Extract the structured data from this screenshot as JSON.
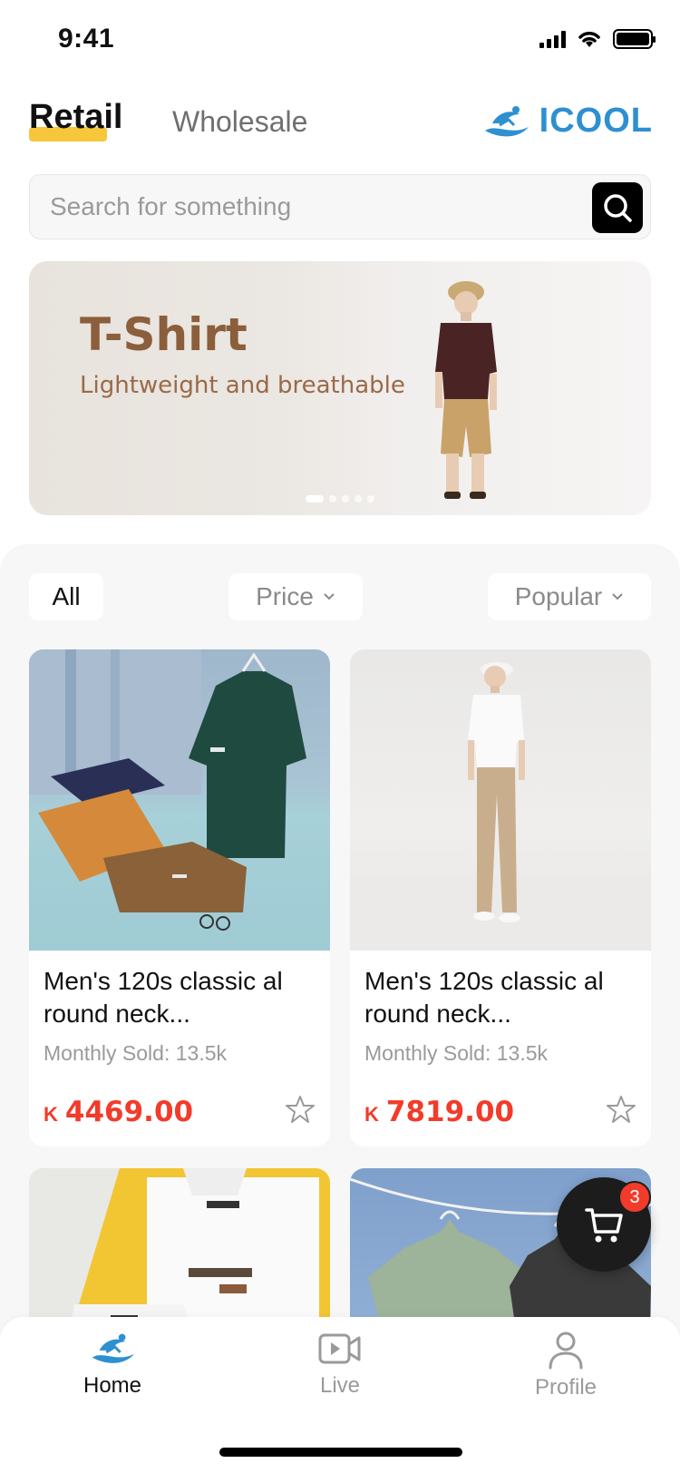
{
  "status_bar": {
    "time": "9:41"
  },
  "header": {
    "tabs": [
      {
        "label": "Retail",
        "active": true
      },
      {
        "label": "Wholesale",
        "active": false
      }
    ],
    "brand": {
      "name": "ICOOL",
      "color": "#2E8FD1"
    }
  },
  "search": {
    "placeholder": "Search for something",
    "icon": "search-icon"
  },
  "banner": {
    "title": "T-Shirt",
    "subtitle": "Lightweight and breathable",
    "slide_count": 5,
    "active_slide": 1
  },
  "filters": {
    "all_label": "All",
    "price_label": "Price",
    "popular_label": "Popular"
  },
  "products": [
    {
      "title": "Men's 120s classic al round neck...",
      "sold": "Monthly Sold: 13.5k",
      "currency": "K",
      "price": "4469.00"
    },
    {
      "title": "Men's 120s classic al round neck...",
      "sold": "Monthly Sold: 13.5k",
      "currency": "K",
      "price": "7819.00"
    }
  ],
  "cart": {
    "count": "3"
  },
  "bottom_nav": [
    {
      "label": "Home",
      "icon": "home-logo-icon",
      "active": true
    },
    {
      "label": "Live",
      "icon": "video-icon",
      "active": false
    },
    {
      "label": "Profile",
      "icon": "user-icon",
      "active": false
    }
  ],
  "colors": {
    "accent": "#F7C63A",
    "price": "#F23B2A",
    "brand": "#2E8FD1",
    "banner_text": "#8B5E3C"
  }
}
